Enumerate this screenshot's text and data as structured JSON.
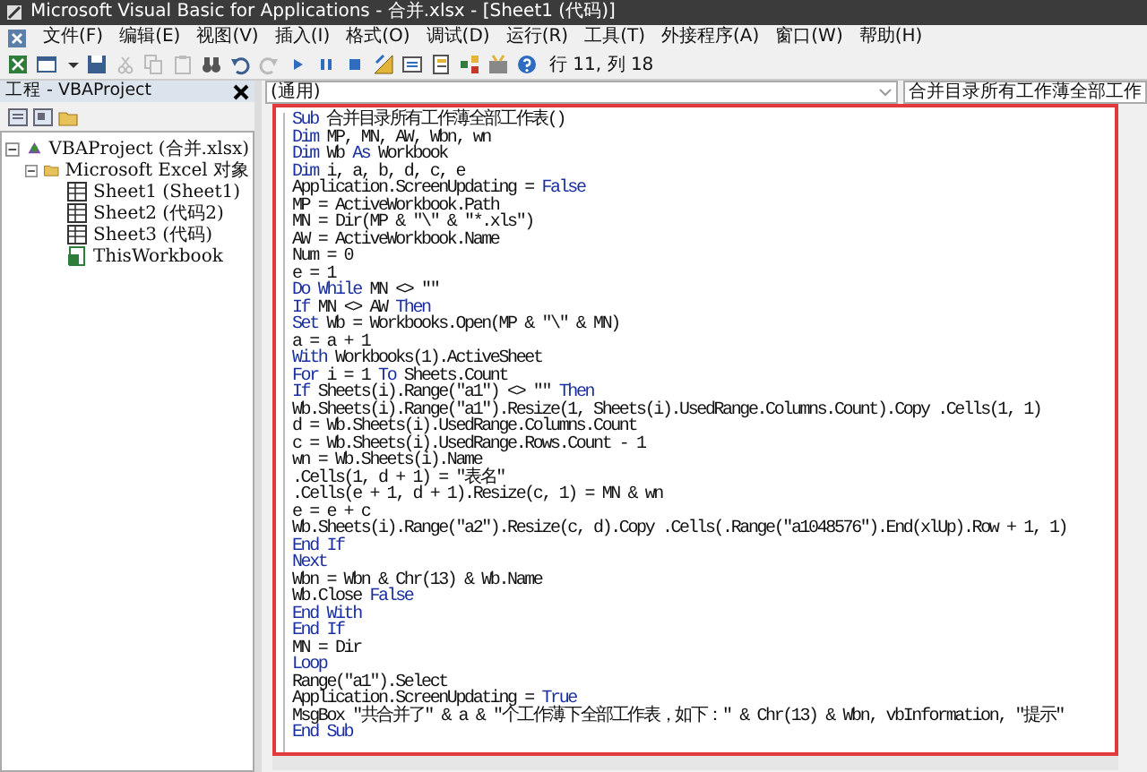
{
  "window": {
    "title": "Microsoft Visual Basic for Applications - 合并.xlsx - [Sheet1 (代码)]"
  },
  "menu": [
    "文件(F)",
    "编辑(E)",
    "视图(V)",
    "插入(I)",
    "格式(O)",
    "调试(D)",
    "运行(R)",
    "工具(T)",
    "外接程序(A)",
    "窗口(W)",
    "帮助(H)"
  ],
  "toolbar": {
    "position": "行 11, 列 18"
  },
  "project_panel": {
    "title": "工程 - VBAProject",
    "tree": [
      {
        "label": "VBAProject (合并.xlsx)",
        "kind": "project",
        "expanded": true,
        "children": [
          {
            "label": "Microsoft Excel 对象",
            "kind": "folder",
            "expanded": true,
            "children": [
              {
                "label": "Sheet1 (Sheet1)",
                "kind": "sheet"
              },
              {
                "label": "Sheet2 (代码2)",
                "kind": "sheet"
              },
              {
                "label": "Sheet3 (代码)",
                "kind": "sheet"
              },
              {
                "label": "ThisWorkbook",
                "kind": "workbook"
              }
            ]
          }
        ]
      }
    ]
  },
  "code_window": {
    "object_dropdown": "(通用)",
    "procedure_dropdown": "合并目录所有工作薄全部工作",
    "lines": [
      [
        {
          "text": "Sub",
          "kind": "keyword"
        },
        {
          "text": " 合并目录所有工作薄全部工作表()",
          "kind": "plain"
        }
      ],
      [
        {
          "text": "Dim",
          "kind": "keyword"
        },
        {
          "text": " MP, MN, AW, Wbn, wn",
          "kind": "plain"
        }
      ],
      [
        {
          "text": "Dim",
          "kind": "keyword"
        },
        {
          "text": " Wb ",
          "kind": "plain"
        },
        {
          "text": "As",
          "kind": "keyword"
        },
        {
          "text": " Workbook",
          "kind": "plain"
        }
      ],
      [
        {
          "text": "Dim",
          "kind": "keyword"
        },
        {
          "text": " i, a, b, d, c, e",
          "kind": "plain"
        }
      ],
      [
        {
          "text": "Application.ScreenUpdating = ",
          "kind": "plain"
        },
        {
          "text": "False",
          "kind": "keyword"
        }
      ],
      [
        {
          "text": "MP = ActiveWorkbook.Path",
          "kind": "plain"
        }
      ],
      [
        {
          "text": "MN = Dir(MP & \"\\\" & \"*.xls\")",
          "kind": "plain"
        }
      ],
      [
        {
          "text": "AW = ActiveWorkbook.Name",
          "kind": "plain"
        }
      ],
      [
        {
          "text": "Num = 0",
          "kind": "plain"
        }
      ],
      [
        {
          "text": "e = 1",
          "kind": "plain"
        }
      ],
      [
        {
          "text": "Do While",
          "kind": "keyword"
        },
        {
          "text": " MN <> \"\"",
          "kind": "plain"
        }
      ],
      [
        {
          "text": "If",
          "kind": "keyword"
        },
        {
          "text": " MN <> AW ",
          "kind": "plain"
        },
        {
          "text": "Then",
          "kind": "keyword"
        }
      ],
      [
        {
          "text": "Set",
          "kind": "keyword"
        },
        {
          "text": " Wb = Workbooks.Open(MP & \"\\\" & MN)",
          "kind": "plain"
        }
      ],
      [
        {
          "text": "a = a + 1",
          "kind": "plain"
        }
      ],
      [
        {
          "text": "With",
          "kind": "keyword"
        },
        {
          "text": " Workbooks(1).ActiveSheet",
          "kind": "plain"
        }
      ],
      [
        {
          "text": "For",
          "kind": "keyword"
        },
        {
          "text": " i = 1 ",
          "kind": "plain"
        },
        {
          "text": "To",
          "kind": "keyword"
        },
        {
          "text": " Sheets.Count",
          "kind": "plain"
        }
      ],
      [
        {
          "text": "If",
          "kind": "keyword"
        },
        {
          "text": " Sheets(i).Range(\"a1\") <> \"\" ",
          "kind": "plain"
        },
        {
          "text": "Then",
          "kind": "keyword"
        }
      ],
      [
        {
          "text": "Wb.Sheets(i).Range(\"a1\").Resize(1, Sheets(i).UsedRange.Columns.Count).Copy .Cells(1, 1)",
          "kind": "plain"
        }
      ],
      [
        {
          "text": "d = Wb.Sheets(i).UsedRange.Columns.Count",
          "kind": "plain"
        }
      ],
      [
        {
          "text": "c = Wb.Sheets(i).UsedRange.Rows.Count - 1",
          "kind": "plain"
        }
      ],
      [
        {
          "text": "wn = Wb.Sheets(i).Name",
          "kind": "plain"
        }
      ],
      [
        {
          "text": ".Cells(1, d + 1) = \"表名\"",
          "kind": "plain"
        }
      ],
      [
        {
          "text": ".Cells(e + 1, d + 1).Resize(c, 1) = MN & wn",
          "kind": "plain"
        }
      ],
      [
        {
          "text": "e = e + c",
          "kind": "plain"
        }
      ],
      [
        {
          "text": "Wb.Sheets(i).Range(\"a2\").Resize(c, d).Copy .Cells(.Range(\"a1048576\").End(xlUp).Row + 1, 1)",
          "kind": "plain"
        }
      ],
      [
        {
          "text": "End If",
          "kind": "keyword"
        }
      ],
      [
        {
          "text": "Next",
          "kind": "keyword"
        }
      ],
      [
        {
          "text": "Wbn = Wbn & Chr(13) & Wb.Name",
          "kind": "plain"
        }
      ],
      [
        {
          "text": "Wb.Close ",
          "kind": "plain"
        },
        {
          "text": "False",
          "kind": "keyword"
        }
      ],
      [
        {
          "text": "End With",
          "kind": "keyword"
        }
      ],
      [
        {
          "text": "End If",
          "kind": "keyword"
        }
      ],
      [
        {
          "text": "MN = Dir",
          "kind": "plain"
        }
      ],
      [
        {
          "text": "Loop",
          "kind": "keyword"
        }
      ],
      [
        {
          "text": "Range(\"a1\").Select",
          "kind": "plain"
        }
      ],
      [
        {
          "text": "Application.ScreenUpdating = ",
          "kind": "plain"
        },
        {
          "text": "True",
          "kind": "keyword"
        }
      ],
      [
        {
          "text": "MsgBox \"共合并了\" & a & \"个工作薄下全部工作表，如下：\" & Chr(13) & Wbn, vbInformation, \"提示\"",
          "kind": "plain"
        }
      ],
      [
        {
          "text": "End Sub",
          "kind": "keyword"
        }
      ]
    ]
  }
}
